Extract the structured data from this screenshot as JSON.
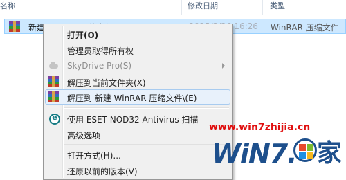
{
  "columns": {
    "name": "名称",
    "date": "修改日期",
    "type": "类型"
  },
  "file": {
    "name": "新建 Wi  RAR 压缩文件",
    "date": "2015/3/26 16:26",
    "type": "WinRAR 压缩文件"
  },
  "menu": {
    "items": [
      {
        "label": "打开(O)",
        "icon": "none"
      },
      {
        "label": "管理员取得所有权",
        "icon": "none"
      },
      {
        "label": "SkyDrive Pro(S)",
        "icon": "cloud-icon"
      },
      {
        "label": "解压到当前文件夹(X)",
        "icon": "winrar-icon"
      },
      {
        "label": "解压到 新建 WinRAR 压缩文件\\(E)",
        "icon": "winrar-icon"
      },
      {
        "label": "使用 ESET NOD32 Antivirus 扫描",
        "icon": "eset-icon"
      },
      {
        "label": "高级选项",
        "icon": "none"
      },
      {
        "label": "打开方式(H)...",
        "icon": "none"
      },
      {
        "label": "还原以前的版本(V)",
        "icon": "none"
      }
    ]
  },
  "watermark": {
    "url": "www.win7zhijia.cn",
    "logo_text": "WiN7.",
    "logo_char": "家"
  },
  "colors": {
    "selection": "#cde8ff",
    "menu_highlight": "#e8f1fb",
    "watermark_red": "#e01010",
    "watermark_blue": "#1d4f8c"
  }
}
